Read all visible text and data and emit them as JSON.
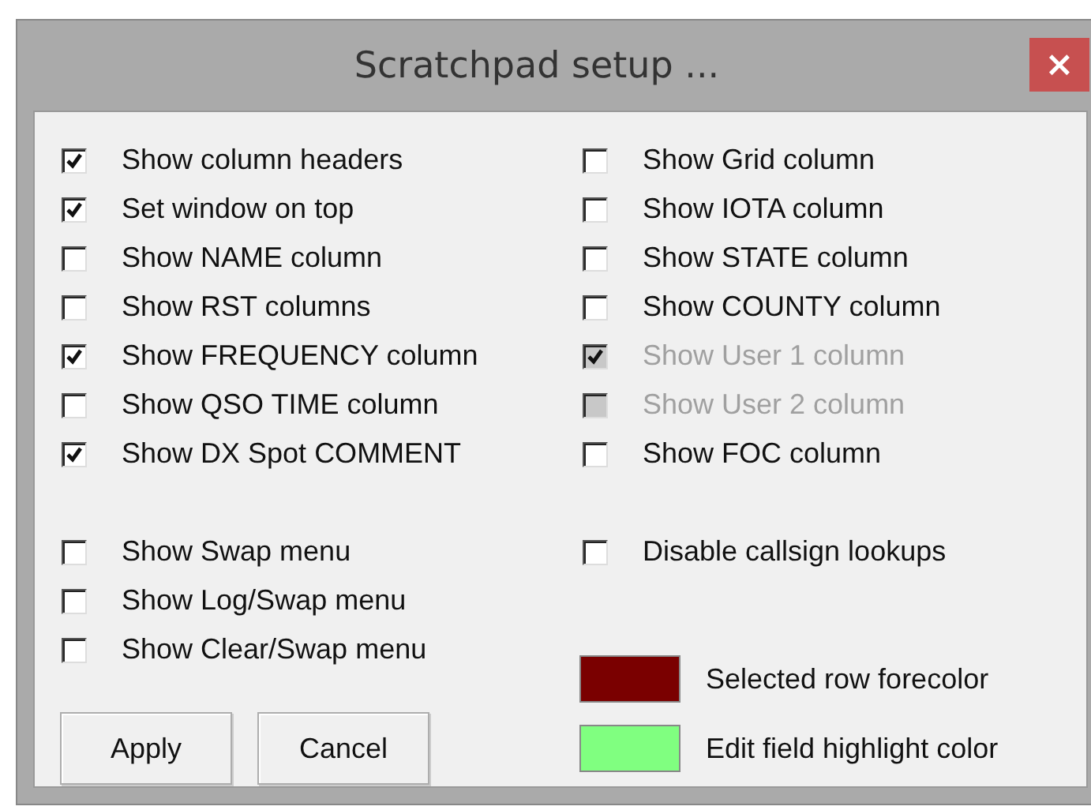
{
  "window": {
    "title": "Scratchpad setup ...",
    "close": "×"
  },
  "left_options": [
    {
      "label": "Show column headers",
      "checked": true,
      "disabled": false
    },
    {
      "label": "Set window on top",
      "checked": true,
      "disabled": false
    },
    {
      "label": "Show NAME column",
      "checked": false,
      "disabled": false
    },
    {
      "label": "Show RST columns",
      "checked": false,
      "disabled": false
    },
    {
      "label": "Show FREQUENCY column",
      "checked": true,
      "disabled": false
    },
    {
      "label": "Show QSO TIME column",
      "checked": false,
      "disabled": false
    },
    {
      "label": "Show DX Spot COMMENT",
      "checked": true,
      "disabled": false
    }
  ],
  "left_menu_options": [
    {
      "label": "Show Swap menu",
      "checked": false,
      "disabled": false
    },
    {
      "label": "Show Log/Swap menu",
      "checked": false,
      "disabled": false
    },
    {
      "label": "Show Clear/Swap menu",
      "checked": false,
      "disabled": false
    }
  ],
  "right_options": [
    {
      "label": "Show Grid column",
      "checked": false,
      "disabled": false
    },
    {
      "label": "Show IOTA column",
      "checked": false,
      "disabled": false
    },
    {
      "label": "Show STATE column",
      "checked": false,
      "disabled": false
    },
    {
      "label": "Show COUNTY column",
      "checked": false,
      "disabled": false
    },
    {
      "label": "Show User 1 column",
      "checked": true,
      "disabled": true
    },
    {
      "label": "Show User 2 column",
      "checked": false,
      "disabled": true
    },
    {
      "label": "Show FOC column",
      "checked": false,
      "disabled": false
    }
  ],
  "right_extra_options": [
    {
      "label": "Disable callsign lookups",
      "checked": false,
      "disabled": false
    }
  ],
  "colors": [
    {
      "label": "Selected row forecolor",
      "color": "#7a0000"
    },
    {
      "label": "Edit field highlight color",
      "color": "#80ff80"
    }
  ],
  "buttons": [
    "Apply",
    "Cancel"
  ]
}
